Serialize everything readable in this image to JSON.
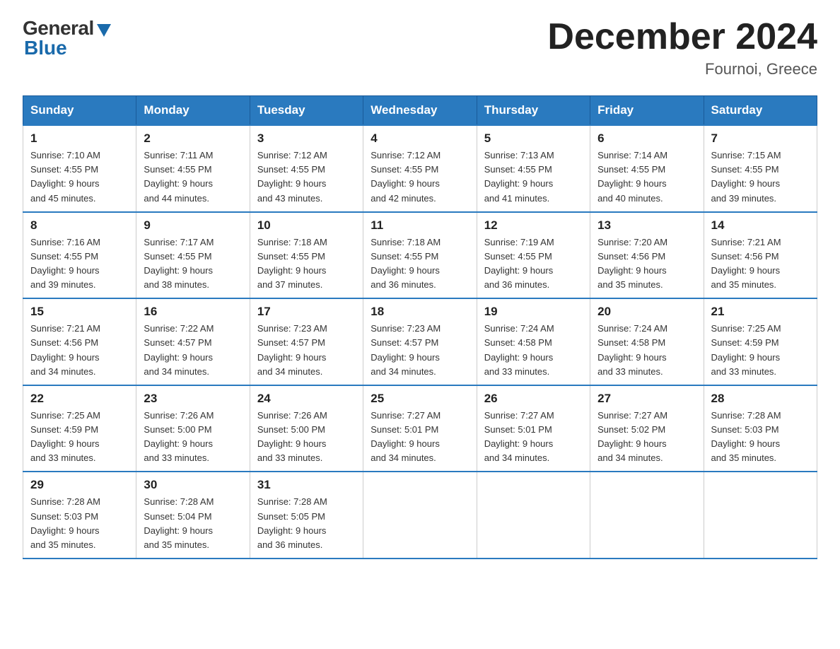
{
  "logo": {
    "general": "General",
    "blue": "Blue"
  },
  "title": "December 2024",
  "location": "Fournoi, Greece",
  "days_of_week": [
    "Sunday",
    "Monday",
    "Tuesday",
    "Wednesday",
    "Thursday",
    "Friday",
    "Saturday"
  ],
  "weeks": [
    [
      {
        "day": "1",
        "sunrise": "7:10 AM",
        "sunset": "4:55 PM",
        "daylight": "9 hours and 45 minutes."
      },
      {
        "day": "2",
        "sunrise": "7:11 AM",
        "sunset": "4:55 PM",
        "daylight": "9 hours and 44 minutes."
      },
      {
        "day": "3",
        "sunrise": "7:12 AM",
        "sunset": "4:55 PM",
        "daylight": "9 hours and 43 minutes."
      },
      {
        "day": "4",
        "sunrise": "7:12 AM",
        "sunset": "4:55 PM",
        "daylight": "9 hours and 42 minutes."
      },
      {
        "day": "5",
        "sunrise": "7:13 AM",
        "sunset": "4:55 PM",
        "daylight": "9 hours and 41 minutes."
      },
      {
        "day": "6",
        "sunrise": "7:14 AM",
        "sunset": "4:55 PM",
        "daylight": "9 hours and 40 minutes."
      },
      {
        "day": "7",
        "sunrise": "7:15 AM",
        "sunset": "4:55 PM",
        "daylight": "9 hours and 39 minutes."
      }
    ],
    [
      {
        "day": "8",
        "sunrise": "7:16 AM",
        "sunset": "4:55 PM",
        "daylight": "9 hours and 39 minutes."
      },
      {
        "day": "9",
        "sunrise": "7:17 AM",
        "sunset": "4:55 PM",
        "daylight": "9 hours and 38 minutes."
      },
      {
        "day": "10",
        "sunrise": "7:18 AM",
        "sunset": "4:55 PM",
        "daylight": "9 hours and 37 minutes."
      },
      {
        "day": "11",
        "sunrise": "7:18 AM",
        "sunset": "4:55 PM",
        "daylight": "9 hours and 36 minutes."
      },
      {
        "day": "12",
        "sunrise": "7:19 AM",
        "sunset": "4:55 PM",
        "daylight": "9 hours and 36 minutes."
      },
      {
        "day": "13",
        "sunrise": "7:20 AM",
        "sunset": "4:56 PM",
        "daylight": "9 hours and 35 minutes."
      },
      {
        "day": "14",
        "sunrise": "7:21 AM",
        "sunset": "4:56 PM",
        "daylight": "9 hours and 35 minutes."
      }
    ],
    [
      {
        "day": "15",
        "sunrise": "7:21 AM",
        "sunset": "4:56 PM",
        "daylight": "9 hours and 34 minutes."
      },
      {
        "day": "16",
        "sunrise": "7:22 AM",
        "sunset": "4:57 PM",
        "daylight": "9 hours and 34 minutes."
      },
      {
        "day": "17",
        "sunrise": "7:23 AM",
        "sunset": "4:57 PM",
        "daylight": "9 hours and 34 minutes."
      },
      {
        "day": "18",
        "sunrise": "7:23 AM",
        "sunset": "4:57 PM",
        "daylight": "9 hours and 34 minutes."
      },
      {
        "day": "19",
        "sunrise": "7:24 AM",
        "sunset": "4:58 PM",
        "daylight": "9 hours and 33 minutes."
      },
      {
        "day": "20",
        "sunrise": "7:24 AM",
        "sunset": "4:58 PM",
        "daylight": "9 hours and 33 minutes."
      },
      {
        "day": "21",
        "sunrise": "7:25 AM",
        "sunset": "4:59 PM",
        "daylight": "9 hours and 33 minutes."
      }
    ],
    [
      {
        "day": "22",
        "sunrise": "7:25 AM",
        "sunset": "4:59 PM",
        "daylight": "9 hours and 33 minutes."
      },
      {
        "day": "23",
        "sunrise": "7:26 AM",
        "sunset": "5:00 PM",
        "daylight": "9 hours and 33 minutes."
      },
      {
        "day": "24",
        "sunrise": "7:26 AM",
        "sunset": "5:00 PM",
        "daylight": "9 hours and 33 minutes."
      },
      {
        "day": "25",
        "sunrise": "7:27 AM",
        "sunset": "5:01 PM",
        "daylight": "9 hours and 34 minutes."
      },
      {
        "day": "26",
        "sunrise": "7:27 AM",
        "sunset": "5:01 PM",
        "daylight": "9 hours and 34 minutes."
      },
      {
        "day": "27",
        "sunrise": "7:27 AM",
        "sunset": "5:02 PM",
        "daylight": "9 hours and 34 minutes."
      },
      {
        "day": "28",
        "sunrise": "7:28 AM",
        "sunset": "5:03 PM",
        "daylight": "9 hours and 35 minutes."
      }
    ],
    [
      {
        "day": "29",
        "sunrise": "7:28 AM",
        "sunset": "5:03 PM",
        "daylight": "9 hours and 35 minutes."
      },
      {
        "day": "30",
        "sunrise": "7:28 AM",
        "sunset": "5:04 PM",
        "daylight": "9 hours and 35 minutes."
      },
      {
        "day": "31",
        "sunrise": "7:28 AM",
        "sunset": "5:05 PM",
        "daylight": "9 hours and 36 minutes."
      },
      null,
      null,
      null,
      null
    ]
  ],
  "labels": {
    "sunrise_prefix": "Sunrise: ",
    "sunset_prefix": "Sunset: ",
    "daylight_prefix": "Daylight: "
  }
}
